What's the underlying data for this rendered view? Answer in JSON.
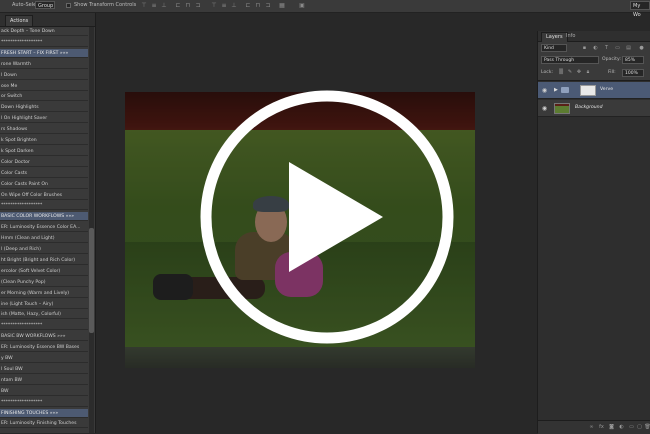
{
  "options_bar": {
    "auto_select_label": "Auto-Select:",
    "auto_select_value": "Group",
    "show_transform_label": "Show Transform Controls",
    "workspace_label": "My Wo"
  },
  "left_panel": {
    "tabs": [
      "",
      "Actions"
    ],
    "actions": [
      {
        "label": "ack Depth – Tone Down",
        "highlighted": false
      },
      {
        "label": "******************",
        "highlighted": false
      },
      {
        "label": "FRESH START – FIX FIRST  »»»",
        "highlighted": true
      },
      {
        "label": "rone Warmth",
        "highlighted": false
      },
      {
        "label": "l Down",
        "highlighted": false
      },
      {
        "label": "ose Me",
        "highlighted": false
      },
      {
        "label": "or Switch",
        "highlighted": false
      },
      {
        "label": "Down Highlights",
        "highlighted": false
      },
      {
        "label": "l On Highlight Saver",
        "highlighted": false
      },
      {
        "label": "rs Shadows",
        "highlighted": false
      },
      {
        "label": "k Spot Brighten",
        "highlighted": false
      },
      {
        "label": "k Spot Darken",
        "highlighted": false
      },
      {
        "label": "Color Doctor",
        "highlighted": false
      },
      {
        "label": "Color Casts",
        "highlighted": false
      },
      {
        "label": "Color Casts Paint On",
        "highlighted": false
      },
      {
        "label": "On Wipe Off Color Brushes",
        "highlighted": false
      },
      {
        "label": "******************",
        "highlighted": false
      },
      {
        "label": "BASIC COLOR WORKFLOWS  »»»",
        "highlighted": true
      },
      {
        "label": "ER: Luminosity Essence Color EA...",
        "highlighted": false
      },
      {
        "label": "Hmm (Clean and Light)",
        "highlighted": false
      },
      {
        "label": "l (Deep and Rich)",
        "highlighted": false
      },
      {
        "label": "ht Bright (Bright and Rich Color)",
        "highlighted": false
      },
      {
        "label": "ercolor (Soft Velvet Color)",
        "highlighted": false
      },
      {
        "label": "(Clean Punchy Pop)",
        "highlighted": false
      },
      {
        "label": "er Morning (Warm and Lively)",
        "highlighted": false
      },
      {
        "label": "ine (Light Touch – Airy)",
        "highlighted": false
      },
      {
        "label": "ish (Matte, Hazy, Colorful)",
        "highlighted": false
      },
      {
        "label": "******************",
        "highlighted": false
      },
      {
        "label": "BASIC BW WORKFLOWS  »»»",
        "highlighted": false
      },
      {
        "label": "ER: Luminosity Essence BW Bases",
        "highlighted": false
      },
      {
        "label": "y BW",
        "highlighted": false
      },
      {
        "label": "l Soul BW",
        "highlighted": false
      },
      {
        "label": "ntam BW",
        "highlighted": false
      },
      {
        "label": "BW",
        "highlighted": false
      },
      {
        "label": "******************",
        "highlighted": false
      },
      {
        "label": "FINISHING TOUCHES  »»»",
        "highlighted": true
      },
      {
        "label": "ER: Luminosity Finishing Touches",
        "highlighted": false
      }
    ]
  },
  "layers_panel": {
    "tabs": [
      "Layers",
      "Info"
    ],
    "filter_value": "Kind",
    "blend_mode": "Pass Through",
    "opacity_label": "Opacity:",
    "opacity_value": "85%",
    "lock_label": "Lock:",
    "fill_label": "Fill:",
    "fill_value": "100%",
    "layers": [
      {
        "name": "Verve",
        "type": "group",
        "selected": true
      },
      {
        "name": "Background",
        "type": "pixel",
        "selected": false
      }
    ]
  },
  "icons": {
    "play": "play-icon",
    "eye": "eye-icon",
    "folder": "folder-icon"
  },
  "colors": {
    "selection": "#4b5a75",
    "panel": "#3a3a3a",
    "canvas_bg": "#282828",
    "play_overlay": "#ffffff"
  }
}
